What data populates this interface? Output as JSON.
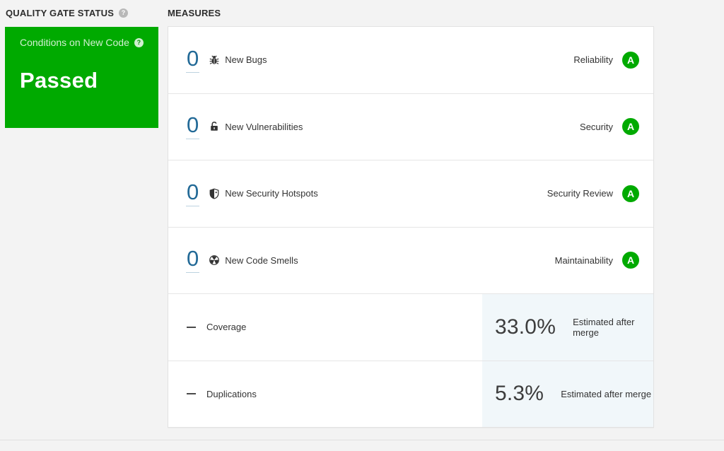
{
  "colors": {
    "page_bg": "#f3f3f3",
    "card_bg": "#ffffff",
    "success_green": "#00aa00",
    "link_blue": "#236a97",
    "text": "#333333",
    "separator": "#e6e6e6",
    "estimate_bg": "#f1f7fa"
  },
  "icons": {
    "help": "?"
  },
  "quality_gate": {
    "title": "QUALITY GATE STATUS",
    "conditions_label": "Conditions on New Code",
    "status": "Passed"
  },
  "measures": {
    "title": "MEASURES",
    "rows": [
      {
        "value": "0",
        "icon": "bug-icon",
        "label": "New Bugs",
        "domain": "Reliability",
        "rating": "A"
      },
      {
        "value": "0",
        "icon": "lock-icon",
        "label": "New Vulnerabilities",
        "domain": "Security",
        "rating": "A"
      },
      {
        "value": "0",
        "icon": "security-hotspot-icon",
        "label": "New Security Hotspots",
        "domain": "Security Review",
        "rating": "A"
      },
      {
        "value": "0",
        "icon": "code-smell-icon",
        "label": "New Code Smells",
        "domain": "Maintainability",
        "rating": "A"
      }
    ],
    "metric_rows": [
      {
        "icon": "dash-icon",
        "label": "Coverage",
        "value": "33.0%",
        "note": "Estimated after merge"
      },
      {
        "icon": "dash-icon",
        "label": "Duplications",
        "value": "5.3%",
        "note": "Estimated after merge"
      }
    ]
  }
}
